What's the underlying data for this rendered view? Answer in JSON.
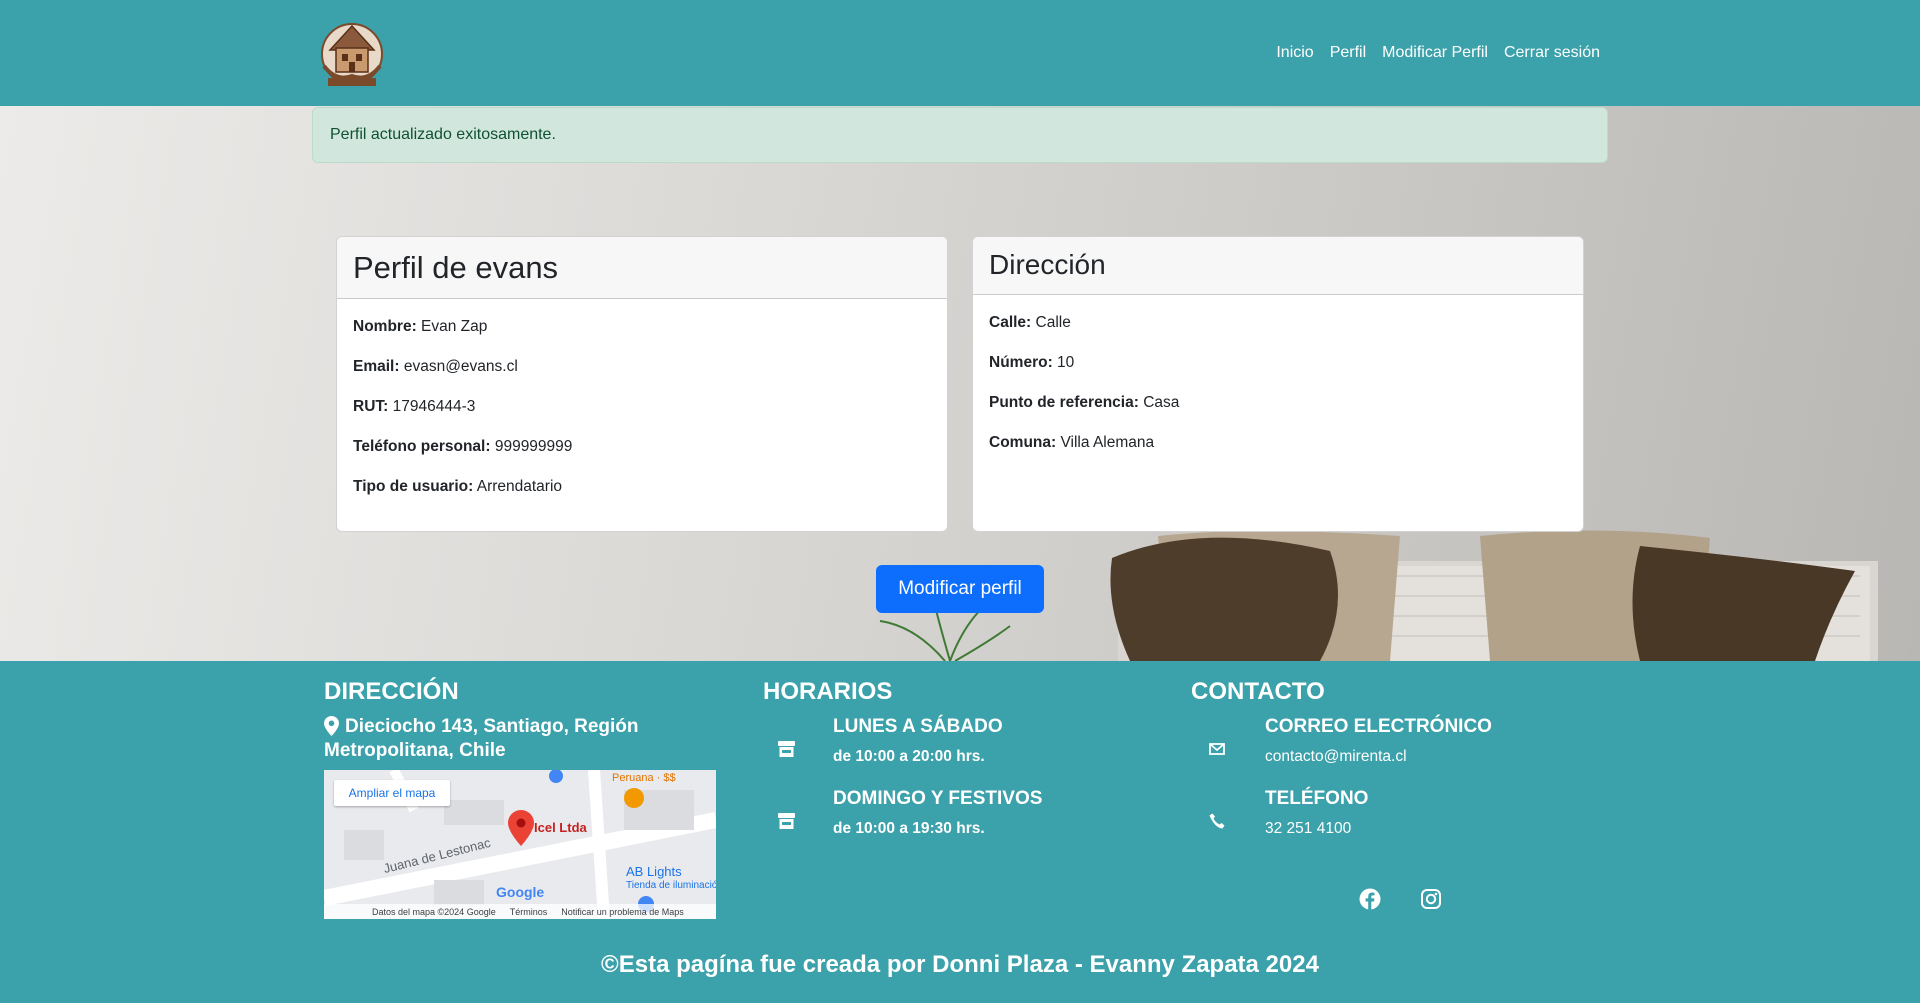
{
  "nav": {
    "logo_alt": "Mi Renta",
    "links": [
      "Inicio",
      "Perfil",
      "Modificar Perfil",
      "Cerrar sesión"
    ]
  },
  "alert": {
    "message": "Perfil actualizado exitosamente."
  },
  "profile": {
    "title": "Perfil de evans",
    "fields": [
      {
        "label": "Nombre:",
        "value": "Evan Zap"
      },
      {
        "label": "Email:",
        "value": "evasn@evans.cl"
      },
      {
        "label": "RUT:",
        "value": "17946444-3"
      },
      {
        "label": "Teléfono personal:",
        "value": "999999999"
      },
      {
        "label": "Tipo de usuario:",
        "value": "Arrendatario"
      }
    ]
  },
  "address": {
    "title": "Dirección",
    "fields": [
      {
        "label": "Calle:",
        "value": "Calle"
      },
      {
        "label": "Número:",
        "value": "10"
      },
      {
        "label": "Punto de referencia:",
        "value": "Casa"
      },
      {
        "label": "Comuna:",
        "value": "Villa Alemana"
      }
    ]
  },
  "modify_button": "Modificar perfil",
  "footer": {
    "direccion": {
      "title": "DIRECCIÓN",
      "line1": "Dieciocho 143, Santiago, Región",
      "line2": "Metropolitana, Chile"
    },
    "map": {
      "expand": "Ampliar el mapa",
      "place": "Icel Ltda",
      "street": "Juana de Lestonac",
      "poi1": "Peruana · $$",
      "poi2": "AB Lights",
      "poi2_sub": "Tienda de iluminación",
      "brand": "Google",
      "data": "Datos del mapa ©2024 Google",
      "terms": "Términos",
      "report": "Notificar un problema de Maps"
    },
    "horarios": {
      "title": "HORARIOS",
      "rows": [
        {
          "label": "LUNES A SÁBADO",
          "value": "de 10:00 a 20:00 hrs."
        },
        {
          "label": "DOMINGO Y FESTIVOS",
          "value": "de 10:00 a 19:30 hrs."
        }
      ]
    },
    "contacto": {
      "title": "CONTACTO",
      "rows": [
        {
          "label": "CORREO ELECTRÓNICO",
          "value": "contacto@mirenta.cl"
        },
        {
          "label": "TELÉFONO",
          "value": "32 251 4100"
        }
      ]
    },
    "copyright": "©Esta pagína fue creada por Donni Plaza - Evanny Zapata 2024"
  },
  "colors": {
    "teal": "#3ba1aa",
    "primary": "#0d6efd",
    "alert_bg": "#d1e7dd",
    "alert_text": "#0f5132"
  }
}
